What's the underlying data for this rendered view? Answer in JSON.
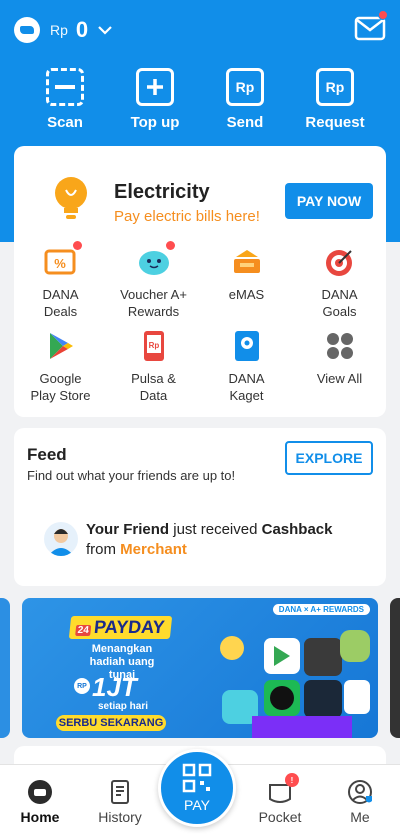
{
  "header": {
    "currency": "Rp",
    "balance": "0"
  },
  "quick_actions": [
    {
      "label": "Scan",
      "icon": "scan-icon"
    },
    {
      "label": "Top up",
      "icon": "top-up-icon"
    },
    {
      "label": "Send",
      "icon": "send-icon",
      "glyph": "Rp"
    },
    {
      "label": "Request",
      "icon": "request-icon",
      "glyph": "Rp"
    }
  ],
  "promo": {
    "title": "Electricity",
    "subtitle": "Pay electric bills here!",
    "button": "PAY NOW"
  },
  "services": [
    {
      "label": "DANA\nDeals",
      "icon": "dana-deals-icon"
    },
    {
      "label": "Voucher A+\nRewards",
      "icon": "voucher-rewards-icon"
    },
    {
      "label": "eMAS",
      "icon": "emas-icon"
    },
    {
      "label": "DANA\nGoals",
      "icon": "dana-goals-icon"
    },
    {
      "label": "Google\nPlay Store",
      "icon": "google-play-icon"
    },
    {
      "label": "Pulsa &\nData",
      "icon": "pulsa-data-icon",
      "glyph": "Rp"
    },
    {
      "label": "DANA\nKaget",
      "icon": "dana-kaget-icon"
    },
    {
      "label": "View All",
      "icon": "view-all-icon"
    }
  ],
  "feed": {
    "title": "Feed",
    "subtitle": "Find out what your friends are up to!",
    "button": "EXPLORE",
    "item": {
      "actor": "Your Friend",
      "action": " just received ",
      "object": "Cashback",
      "from": "from ",
      "merchant": "Merchant"
    }
  },
  "banner": {
    "tag_num": "24",
    "tag": "PAYDAY",
    "line": "Menangkan hadiah uang tunai",
    "rp": "RP",
    "amount": "1JT",
    "small": "setiap hari",
    "cta": "SERBU SEKARANG",
    "brand": "DANA × A+ REWARDS"
  },
  "bottom_nav": [
    {
      "label": "Home",
      "icon": "home-icon",
      "active": true
    },
    {
      "label": "History",
      "icon": "history-icon"
    },
    {
      "label": "PAY",
      "icon": "pay-qr-icon"
    },
    {
      "label": "Pocket",
      "icon": "pocket-icon"
    },
    {
      "label": "Me",
      "icon": "me-icon"
    }
  ],
  "colors": {
    "brand_blue": "#118ee9",
    "accent_orange": "#f58e1f",
    "badge_red": "#ff4d4f"
  }
}
